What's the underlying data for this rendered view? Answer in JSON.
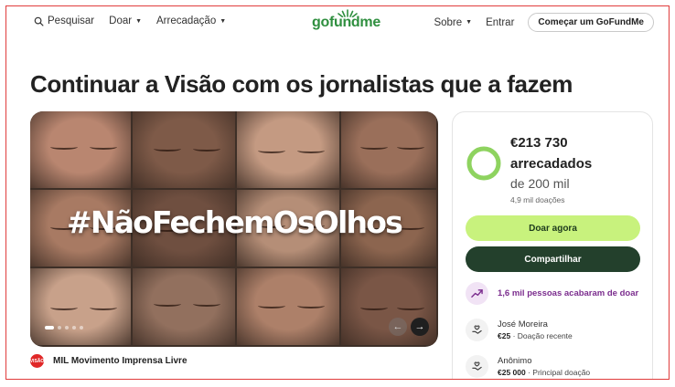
{
  "header": {
    "search_label": "Pesquisar",
    "donate_label": "Doar",
    "fundraising_label": "Arrecadação",
    "logo_text": "gofundme",
    "about_label": "Sobre",
    "login_label": "Entrar",
    "start_label": "Começar um GoFundMe"
  },
  "campaign": {
    "title": "Continuar a Visão com os jornalistas que a fazem",
    "hero_hashtag": "#NãoFechemOsOlhos",
    "organizer_badge": "VISÃO",
    "organizer_name": "MIL Movimento Imprensa Livre"
  },
  "donation": {
    "amount": "€213 730",
    "raised_label": "arrecadados",
    "goal": "de 200 mil",
    "donation_count": "4,9 mil doações",
    "progress_fraction": 1.0,
    "donate_button": "Doar agora",
    "share_button": "Compartilhar",
    "recent_activity": "1,6 mil pessoas acabaram de doar",
    "donors": [
      {
        "name": "José Moreira",
        "amount": "€25",
        "detail": "· Doação recente"
      },
      {
        "name": "Anônimo",
        "amount": "€25 000",
        "detail": "· Principal doação"
      }
    ]
  },
  "colors": {
    "brand_green": "#2f8f3f",
    "donate_button": "#c8f27d",
    "share_button": "#23402c",
    "progress_ring": "#8ed35f",
    "recent_purple": "#7b2d8e"
  }
}
